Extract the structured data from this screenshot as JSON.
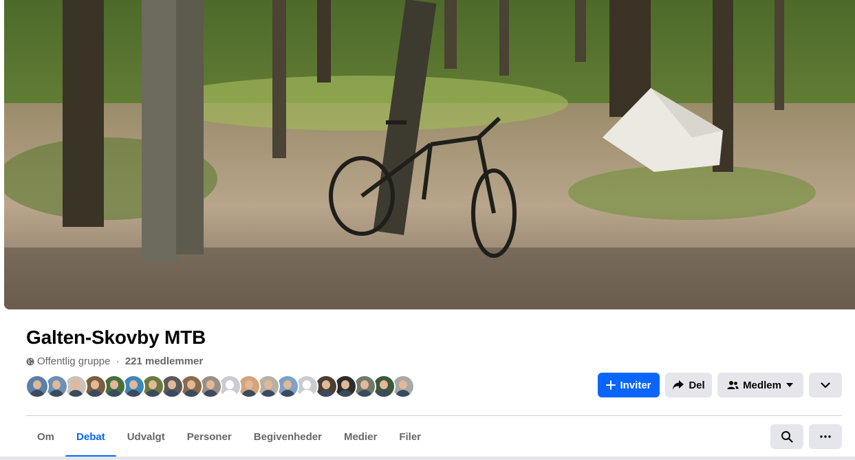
{
  "cover": {
    "alt": "Cover photo"
  },
  "group": {
    "name": "Galten-Skovby MTB",
    "privacy": "Offentlig gruppe",
    "separator": " · ",
    "members": "221 medlemmer"
  },
  "member_avatars": {
    "count": 20,
    "colors": [
      "#5b7fa8",
      "#6e8fb8",
      "#c9c3b8",
      "#7b5e3e",
      "#4a6f3d",
      "#3f87b8",
      "#6b7a3d",
      "#5a5a5a",
      "#8a6b4b",
      "#9a8f88",
      "#c9ccd1",
      "#d4a37a",
      "#b8b0a5",
      "#7ea1c7",
      "#c9ccd1",
      "#4b3f2f",
      "#2c2c2c",
      "#6f7a6a",
      "#3a5a3a",
      "#a8a8a8"
    ]
  },
  "actions": {
    "invite_label": "Inviter",
    "share_label": "Del",
    "member_label": "Medlem"
  },
  "tabs": [
    {
      "label": "Om",
      "active": false
    },
    {
      "label": "Debat",
      "active": true
    },
    {
      "label": "Udvalgt",
      "active": false
    },
    {
      "label": "Personer",
      "active": false
    },
    {
      "label": "Begivenheder",
      "active": false
    },
    {
      "label": "Medier",
      "active": false
    },
    {
      "label": "Filer",
      "active": false
    }
  ],
  "colors": {
    "accent": "#0866ff",
    "secondary_button": "#e4e6eb",
    "muted_text": "#65676b"
  },
  "icons": {
    "privacy": "globe-icon",
    "invite": "plus-icon",
    "share": "share-arrow-icon",
    "member": "people-icon",
    "member_caret": "caret-down-icon",
    "collapse": "chevron-down-icon",
    "search": "search-icon",
    "more": "more-dots-icon"
  }
}
